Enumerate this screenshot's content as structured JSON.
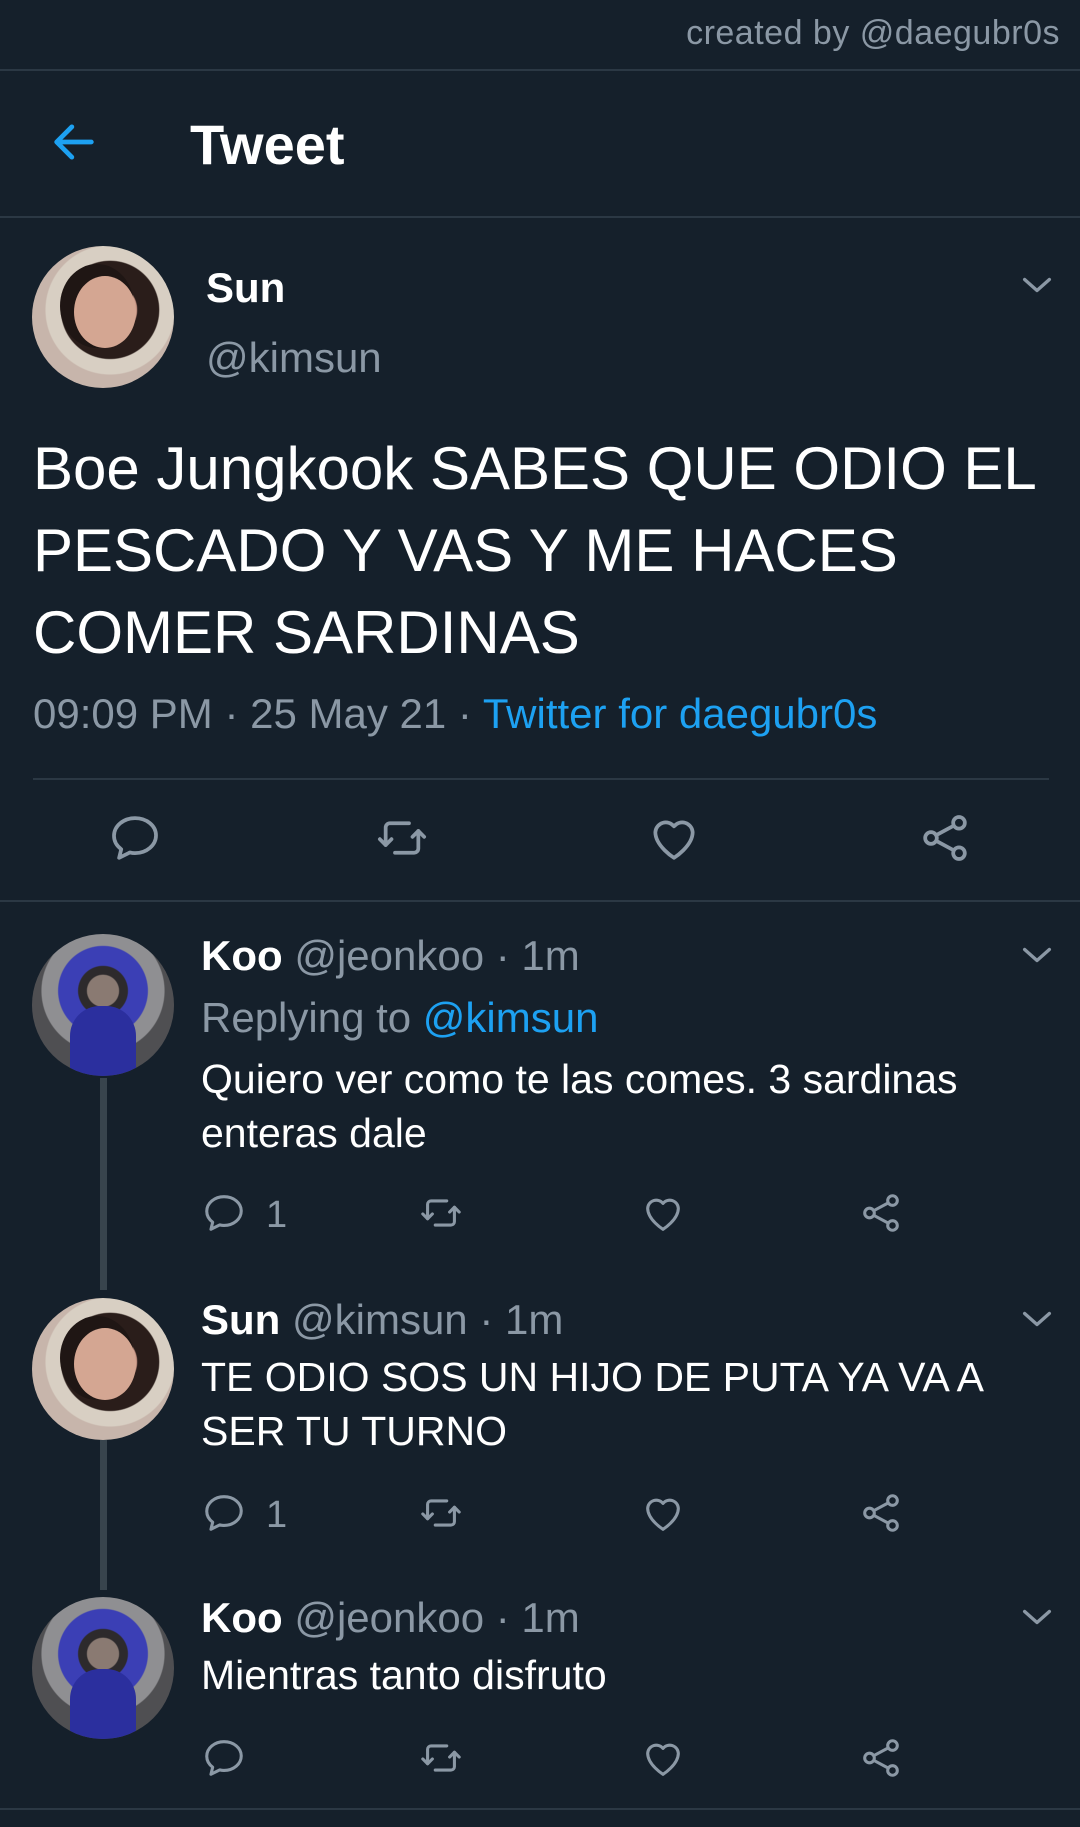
{
  "credit": "created by @daegubr0s",
  "header": {
    "title": "Tweet"
  },
  "main_tweet": {
    "name": "Sun",
    "handle": "@kimsun",
    "text": "Boe Jungkook SABES QUE ODIO EL PESCADO Y VAS Y ME HACES COMER SARDINAS",
    "time": "09:09 PM",
    "sep": "·",
    "date": "25 May 21",
    "via": "Twitter for daegubr0s"
  },
  "replies": [
    {
      "name": "Koo",
      "handle": "@jeonkoo",
      "time": "· 1m",
      "replying_label": "Replying to",
      "replying_to": "@kimsun",
      "text": "Quiero ver como te las comes. 3 sardinas enteras dale",
      "reply_count": "1"
    },
    {
      "name": "Sun",
      "handle": "@kimsun",
      "time": "· 1m",
      "text": "TE ODIO SOS UN HIJO DE PUTA YA VA A SER TU TURNO",
      "reply_count": "1"
    },
    {
      "name": "Koo",
      "handle": "@jeonkoo",
      "time": "· 1m",
      "text": "Mientras tanto disfruto"
    }
  ],
  "icons": {
    "back": "back-arrow-icon",
    "more": "chevron-down-icon",
    "reply": "comment-icon",
    "retweet": "retweet-icon",
    "like": "heart-icon",
    "share": "share-icon"
  },
  "colors": {
    "background": "#15202b",
    "accent": "#1da1f2",
    "secondary_text": "#8b98a5",
    "divider": "#2b3844"
  }
}
